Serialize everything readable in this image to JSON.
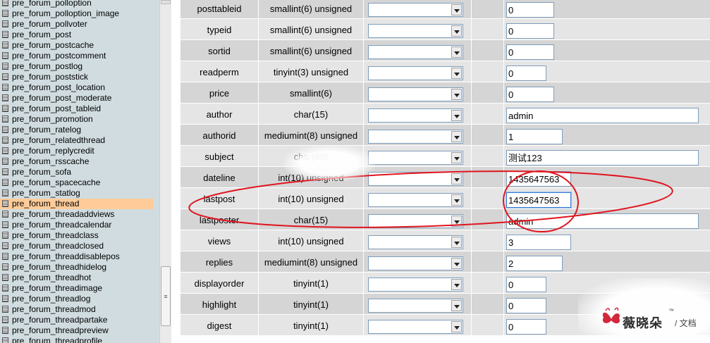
{
  "sidebar": {
    "tables": [
      "pre_forum_polloption",
      "pre_forum_polloption_image",
      "pre_forum_pollvoter",
      "pre_forum_post",
      "pre_forum_postcache",
      "pre_forum_postcomment",
      "pre_forum_postlog",
      "pre_forum_poststick",
      "pre_forum_post_location",
      "pre_forum_post_moderate",
      "pre_forum_post_tableid",
      "pre_forum_promotion",
      "pre_forum_ratelog",
      "pre_forum_relatedthread",
      "pre_forum_replycredit",
      "pre_forum_rsscache",
      "pre_forum_sofa",
      "pre_forum_spacecache",
      "pre_forum_statlog",
      "pre_forum_thread",
      "pre_forum_threadaddviews",
      "pre_forum_threadcalendar",
      "pre_forum_threadclass",
      "pre_forum_threadclosed",
      "pre_forum_threaddisablepos",
      "pre_forum_threadhidelog",
      "pre_forum_threadhot",
      "pre_forum_threadimage",
      "pre_forum_threadlog",
      "pre_forum_threadmod",
      "pre_forum_threadpartake",
      "pre_forum_threadpreview",
      "pre_forum_threadprofile"
    ],
    "selected_table": "pre_forum_thread",
    "table_icon": "table-icon",
    "scrollbar_grip": "≡"
  },
  "fields": [
    {
      "name": "posttableid",
      "type": "smallint(6) unsigned",
      "value": "0"
    },
    {
      "name": "typeid",
      "type": "smallint(6) unsigned",
      "value": "0"
    },
    {
      "name": "sortid",
      "type": "smallint(6) unsigned",
      "value": "0"
    },
    {
      "name": "readperm",
      "type": "tinyint(3) unsigned",
      "value": "0"
    },
    {
      "name": "price",
      "type": "smallint(6)",
      "value": "0"
    },
    {
      "name": "author",
      "type": "char(15)",
      "value": "admin"
    },
    {
      "name": "authorid",
      "type": "mediumint(8) unsigned",
      "value": "1"
    },
    {
      "name": "subject",
      "type": "char(80)",
      "value": "测试123"
    },
    {
      "name": "dateline",
      "type": "int(10) unsigned",
      "value": "1435647563"
    },
    {
      "name": "lastpost",
      "type": "int(10) unsigned",
      "value": "1435647563"
    },
    {
      "name": "lastposter",
      "type": "char(15)",
      "value": "admin"
    },
    {
      "name": "views",
      "type": "int(10) unsigned",
      "value": "3"
    },
    {
      "name": "replies",
      "type": "mediumint(8) unsigned",
      "value": "2"
    },
    {
      "name": "displayorder",
      "type": "tinyint(1)",
      "value": "0"
    },
    {
      "name": "highlight",
      "type": "tinyint(1)",
      "value": "0"
    },
    {
      "name": "digest",
      "type": "tinyint(1)",
      "value": "0"
    }
  ],
  "focused_field": "lastpost",
  "annotation": {
    "color": "#e0141e"
  },
  "watermark": {
    "brand": "薇晓朵",
    "trademark": "™",
    "separator_doc": "/ 文档",
    "logo_color": "#d2283c"
  },
  "colors": {
    "sidebar_bg": "#d0dce0",
    "selected_bg": "#ffcc99",
    "row_odd": "#d5d5d5",
    "row_even": "#e5e5e5"
  }
}
